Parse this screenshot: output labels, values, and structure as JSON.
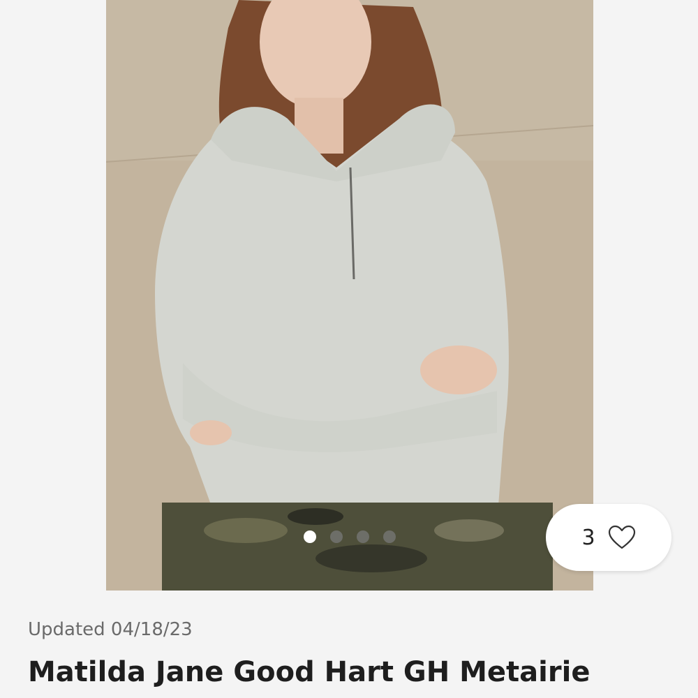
{
  "listing": {
    "updated_text": "Updated 04/18/23",
    "title": "Matilda Jane Good Hart GH Metairie",
    "like_count": "3"
  },
  "carousel": {
    "image_count": 4,
    "active_index": 0
  },
  "icons": {
    "like": "heart-outline-icon"
  },
  "colors": {
    "background": "#f4f4f4",
    "text_primary": "#1e1e1e",
    "text_secondary": "#6a6a6a",
    "dot_active": "#ffffff",
    "dot_inactive": "#787878"
  }
}
